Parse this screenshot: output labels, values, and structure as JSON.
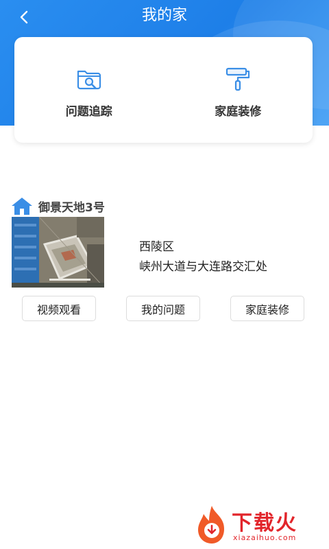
{
  "header": {
    "title": "我的家"
  },
  "menu": {
    "items": [
      {
        "label": "问题追踪",
        "icon": "folder-search-icon"
      },
      {
        "label": "家庭装修",
        "icon": "paint-roller-icon"
      }
    ]
  },
  "house": {
    "name": "御景天地3号",
    "district": "西陵区",
    "address": "峡州大道与大连路交汇处",
    "actions": {
      "video": "视频观看",
      "my_issues": "我的问题",
      "renovation": "家庭装修"
    }
  },
  "watermark": {
    "brand": "下载火",
    "site": "xiazaihuo.com"
  },
  "colors": {
    "primary": "#1e7fe8",
    "icon": "#3a8ee6",
    "watermark": "#e2252b"
  }
}
